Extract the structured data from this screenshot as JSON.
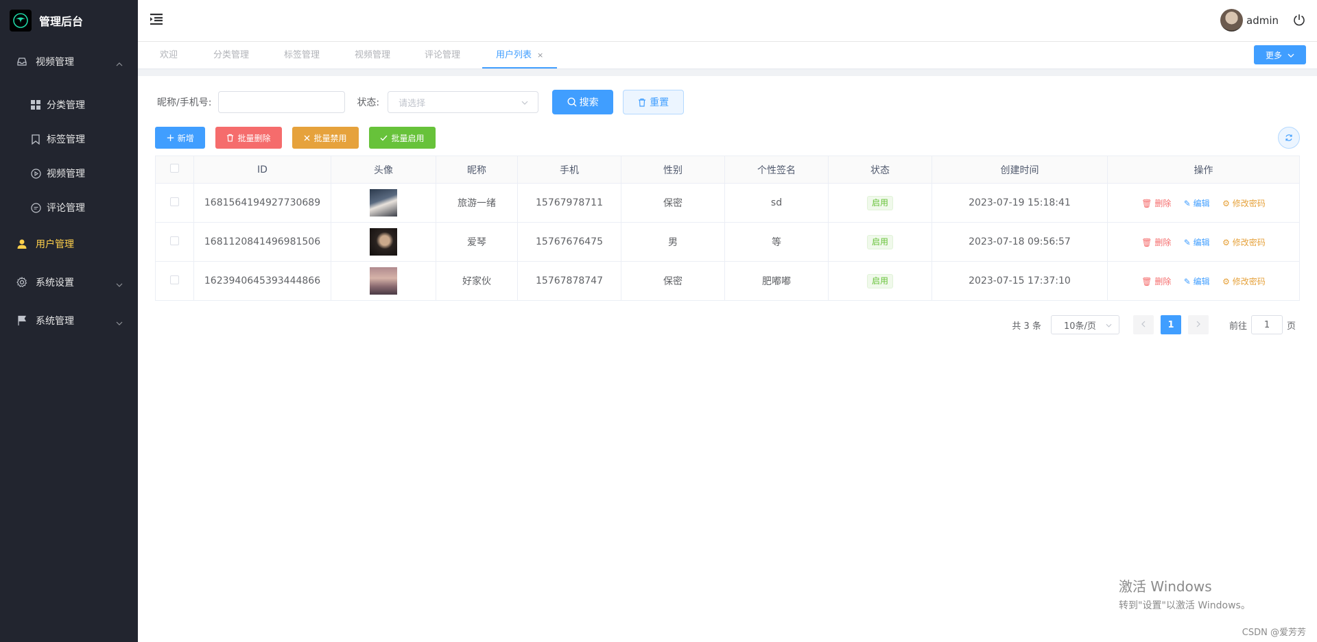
{
  "app": {
    "title": "管理后台"
  },
  "sidebar": {
    "groups": [
      {
        "label": "视频管理",
        "icon": "inbox-icon"
      },
      {
        "label": "用户管理",
        "icon": "user-icon"
      },
      {
        "label": "系统设置",
        "icon": "gear-icon"
      },
      {
        "label": "系统管理",
        "icon": "flag-icon"
      }
    ],
    "sub_items": [
      {
        "label": "分类管理",
        "icon": "grid-icon"
      },
      {
        "label": "标签管理",
        "icon": "bookmark-icon"
      },
      {
        "label": "视频管理",
        "icon": "play-circle-icon"
      },
      {
        "label": "评论管理",
        "icon": "comment-icon"
      }
    ]
  },
  "header": {
    "username": "admin"
  },
  "tabs": [
    "欢迎",
    "分类管理",
    "标签管理",
    "视频管理",
    "评论管理",
    "用户列表"
  ],
  "tab_close": "×",
  "more_label": "更多",
  "search": {
    "nickname_label": "昵称/手机号:",
    "nickname_value": "",
    "status_label": "状态:",
    "status_placeholder": "请选择",
    "search_btn": "搜索",
    "reset_btn": "重置"
  },
  "actions": {
    "add": "新增",
    "batch_delete": "批量删除",
    "batch_disable": "批量禁用",
    "batch_enable": "批量启用"
  },
  "table": {
    "columns": [
      "ID",
      "头像",
      "昵称",
      "手机",
      "性别",
      "个性签名",
      "状态",
      "创建时间",
      "操作"
    ],
    "rows": [
      {
        "id": "1681564194927730689",
        "nickname": "旅游一绪",
        "phone": "15767978711",
        "gender": "保密",
        "signature": "sd",
        "status": "启用",
        "created": "2023-07-19 15:18:41"
      },
      {
        "id": "1681120841496981506",
        "nickname": "爱琴",
        "phone": "15767676475",
        "gender": "男",
        "signature": "等",
        "status": "启用",
        "created": "2023-07-18 09:56:57"
      },
      {
        "id": "1623940645393444866",
        "nickname": "好家伙",
        "phone": "15767878747",
        "gender": "保密",
        "signature": "肥嘟嘟",
        "status": "启用",
        "created": "2023-07-15 17:37:10"
      }
    ],
    "ops": {
      "delete": "删除",
      "edit": "编辑",
      "change_pwd": "修改密码"
    }
  },
  "pagination": {
    "total": "共 3 条",
    "page_size": "10条/页",
    "current": "1",
    "goto_prefix": "前往",
    "goto_value": "1",
    "goto_suffix": "页"
  },
  "watermark": {
    "line1": "激活 Windows",
    "line2": "转到\"设置\"以激活 Windows。"
  },
  "credit": "CSDN @爱芳芳",
  "colors": {
    "sidebar_bg": "#22252f",
    "primary": "#409eff",
    "danger": "#f56c6c",
    "warning": "#e6a23c",
    "success": "#67c23a",
    "active_menu": "#ffd04b"
  }
}
